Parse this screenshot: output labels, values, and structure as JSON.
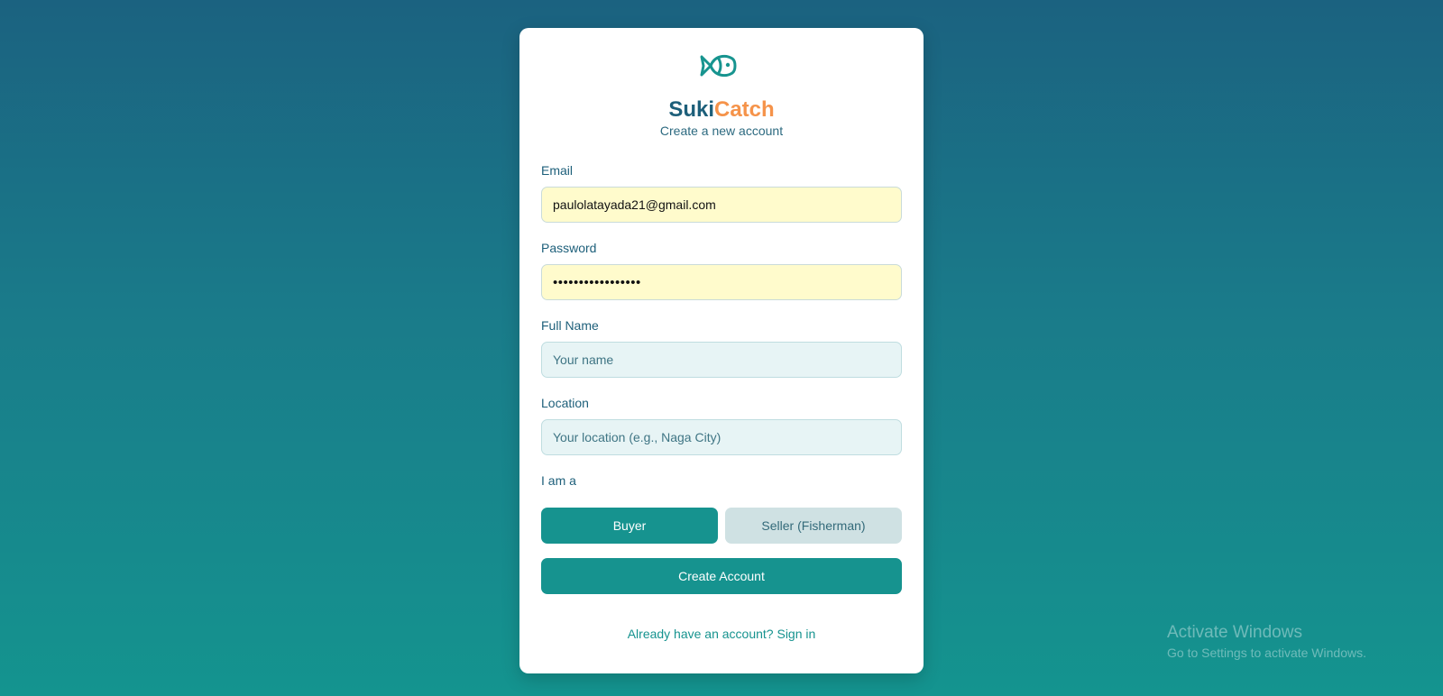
{
  "brand": {
    "name_part1": "Suki",
    "name_part2": "Catch",
    "subtitle": "Create a new account",
    "logo_icon": "fish-icon"
  },
  "form": {
    "email": {
      "label": "Email",
      "value": "paulolatayada21@gmail.com"
    },
    "password": {
      "label": "Password",
      "value": "•••••••••••••••••"
    },
    "full_name": {
      "label": "Full Name",
      "placeholder": "Your name"
    },
    "location": {
      "label": "Location",
      "placeholder": "Your location (e.g., Naga City)"
    },
    "role": {
      "label": "I am a",
      "options": [
        "Buyer",
        "Seller (Fisherman)"
      ],
      "selected": "Buyer"
    },
    "submit_label": "Create Account",
    "signin_link": "Already have an account? Sign in"
  },
  "watermark": {
    "title": "Activate Windows",
    "subtitle": "Go to Settings to activate Windows."
  },
  "colors": {
    "accent": "#16938f",
    "brand_dark": "#1d5f7a",
    "brand_orange": "#f5934a",
    "background_top": "#1b6280",
    "background_bottom": "#14948f"
  }
}
